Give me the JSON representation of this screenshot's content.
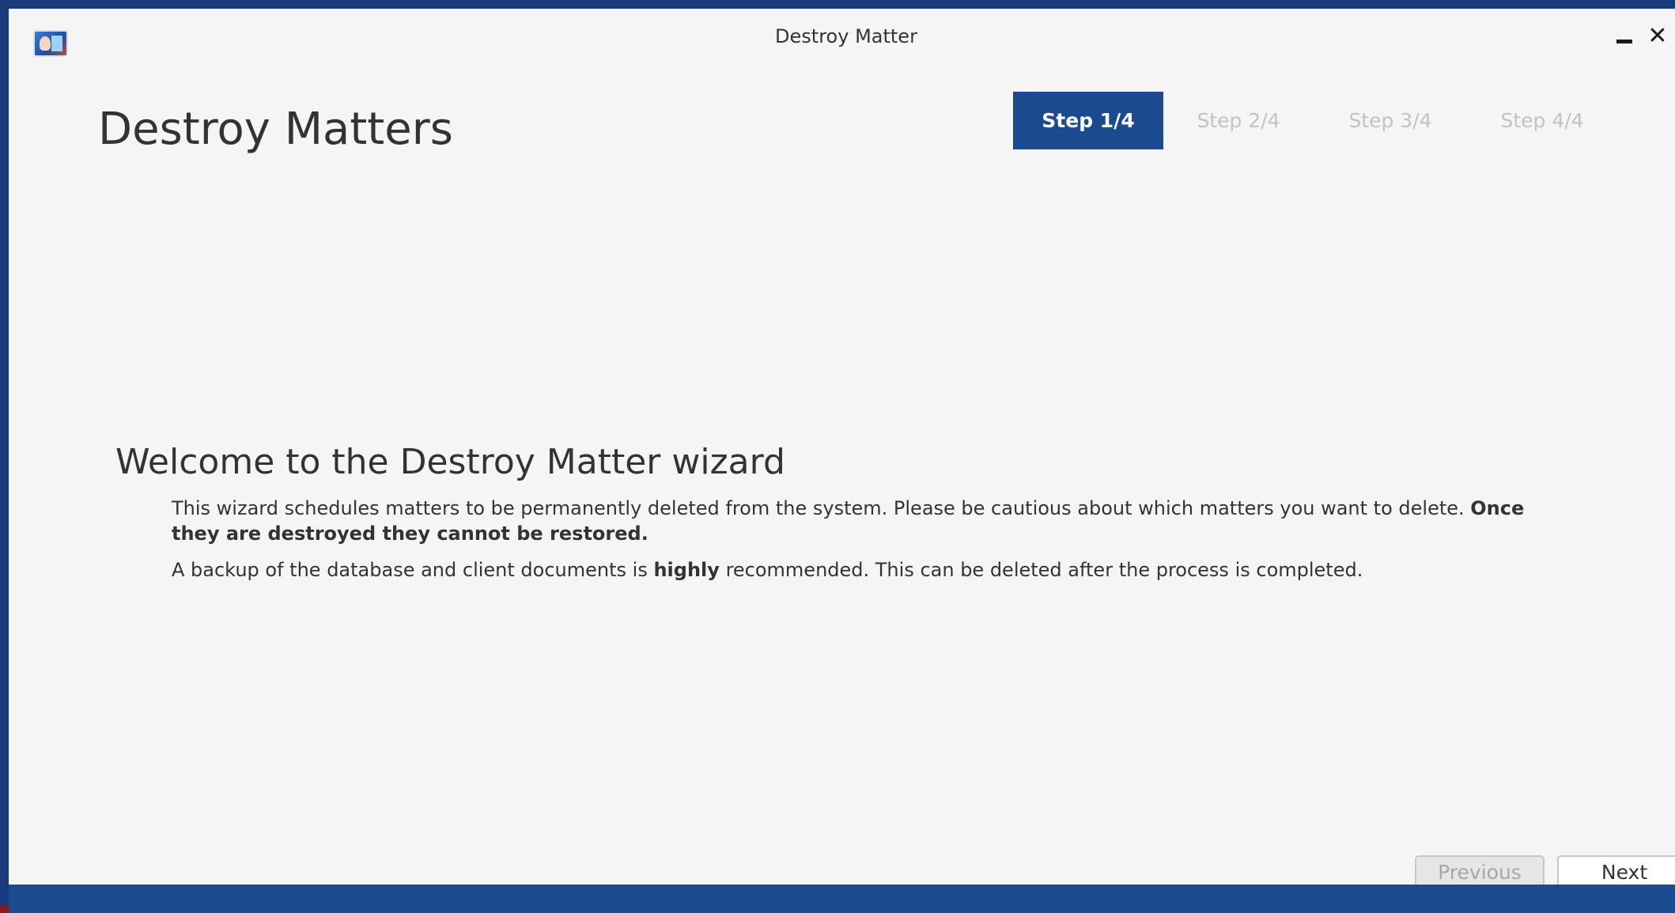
{
  "window": {
    "title": "Destroy Matter",
    "icon": "app-icon",
    "minimize_icon": "minimize-icon",
    "close_glyph": "✕"
  },
  "page": {
    "title": "Destroy Matters"
  },
  "steps": [
    {
      "label": "Step 1/4",
      "active": true
    },
    {
      "label": "Step 2/4",
      "active": false
    },
    {
      "label": "Step 3/4",
      "active": false
    },
    {
      "label": "Step 4/4",
      "active": false
    }
  ],
  "content": {
    "heading": "Welcome to the Destroy Matter wizard",
    "para1_text": "This wizard schedules matters to be permanently deleted from the system. Please be cautious about which matters you want to delete.",
    "para1_bold": "Once they are destroyed they cannot be restored.",
    "para2_before": "A backup of the database and client documents is",
    "para2_bold": "highly",
    "para2_after": "recommended. This can be deleted after the process is completed."
  },
  "buttons": {
    "previous": "Previous",
    "next": "Next"
  },
  "colors": {
    "accent": "#1b4b8f",
    "frame": "#1b3a7a",
    "background": "#f5f5f5",
    "inactive_step": "#c3c3c3"
  }
}
